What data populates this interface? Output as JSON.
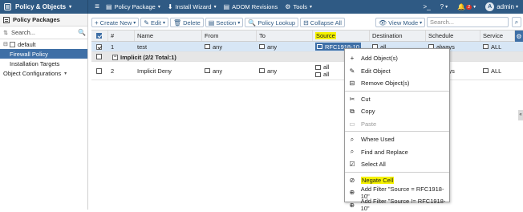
{
  "topbar": {
    "app_title": "Policy & Objects",
    "menus": [
      {
        "label": "Policy Package",
        "icon": "▤",
        "dropdown": true
      },
      {
        "label": "Install Wizard",
        "icon": "⬇",
        "dropdown": true
      },
      {
        "label": "ADOM Revisions",
        "icon": "▤",
        "dropdown": false
      },
      {
        "label": "Tools",
        "icon": "⚙",
        "dropdown": true
      }
    ],
    "notification_count": "2",
    "user_initial": "A",
    "user_name": "admin"
  },
  "sidebar": {
    "title": "Policy Packages",
    "search_placeholder": "Search...",
    "items": [
      {
        "label": "default"
      },
      {
        "label": "Firewall Policy"
      },
      {
        "label": "Installation Targets"
      },
      {
        "label": "Object Configurations"
      }
    ]
  },
  "toolbar": {
    "create_new": "Create New",
    "edit": "Edit",
    "delete": "Delete",
    "section": "Section",
    "policy_lookup": "Policy Lookup",
    "collapse_all": "Collapse All",
    "view_mode": "View Mode",
    "search_placeholder": "Search..."
  },
  "grid": {
    "columns": [
      "#",
      "Name",
      "From",
      "To",
      "Source",
      "Destination",
      "Schedule",
      "Service"
    ],
    "rows": [
      {
        "num": "1",
        "name": "test",
        "from": "any",
        "to": "any",
        "source": "RFC1918-10",
        "destination": "all",
        "schedule": "always",
        "service": "ALL"
      }
    ],
    "section_label": "Implicit (2/2 Total:1)",
    "implicit_rows": [
      {
        "num": "2",
        "name": "Implicit Deny",
        "from": "any",
        "to": "any",
        "source": [
          "all",
          "all"
        ],
        "destination": "all",
        "schedule": "always",
        "service": "ALL"
      }
    ]
  },
  "context_menu": {
    "items": [
      {
        "label": "Add Object(s)",
        "icon": "plus-icon",
        "glyph": "+",
        "disabled": false
      },
      {
        "label": "Edit Object",
        "icon": "edit-icon",
        "glyph": "✎",
        "disabled": false
      },
      {
        "label": "Remove Object(s)",
        "icon": "remove-icon",
        "glyph": "⊟",
        "disabled": false
      },
      {
        "label": "Cut",
        "icon": "cut-icon",
        "glyph": "✂",
        "disabled": false
      },
      {
        "label": "Copy",
        "icon": "copy-icon",
        "glyph": "⧉",
        "disabled": false
      },
      {
        "label": "Paste",
        "icon": "paste-icon",
        "glyph": "📋",
        "disabled": true
      },
      {
        "label": "Where Used",
        "icon": "where-used-icon",
        "glyph": "🔍",
        "disabled": false
      },
      {
        "label": "Find and Replace",
        "icon": "find-replace-icon",
        "glyph": "⌕",
        "disabled": false
      },
      {
        "label": "Select All",
        "icon": "select-all-icon",
        "glyph": "☑",
        "disabled": false
      },
      {
        "label": "Negate Cell",
        "icon": "negate-icon",
        "glyph": "⊘",
        "disabled": false
      },
      {
        "label": "Add Filter \"Source = RFC1918-10\"",
        "icon": "filter-add-icon",
        "glyph": "⊕",
        "disabled": false
      },
      {
        "label": "Add Filter \"Source != RFC1918-10\"",
        "icon": "filter-add-icon",
        "glyph": "⊕",
        "disabled": false
      }
    ]
  },
  "colors": {
    "topbar": "#2f5a84",
    "selection": "#3e6fa6",
    "highlight": "#f5f200"
  }
}
